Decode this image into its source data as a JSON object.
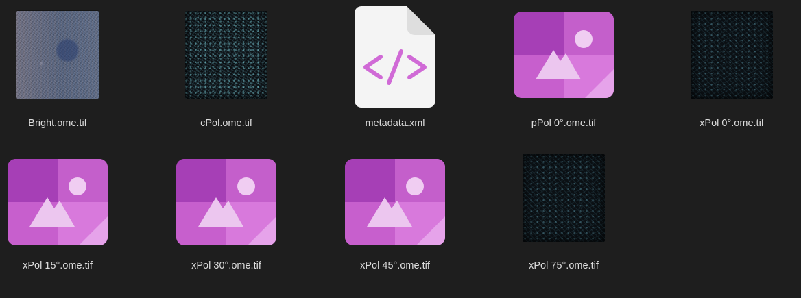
{
  "files": [
    {
      "name": "Bright.ome.tif",
      "thumbnail": "photo-thumbnail"
    },
    {
      "name": "cPol.ome.tif",
      "thumbnail": "photo-thumbnail"
    },
    {
      "name": "metadata.xml",
      "thumbnail": "xml-file-icon"
    },
    {
      "name": "pPol 0°.ome.tif",
      "thumbnail": "image-file-icon"
    },
    {
      "name": "xPol 0°.ome.tif",
      "thumbnail": "photo-thumbnail"
    },
    {
      "name": "xPol 15°.ome.tif",
      "thumbnail": "image-file-icon"
    },
    {
      "name": "xPol 30°.ome.tif",
      "thumbnail": "image-file-icon"
    },
    {
      "name": "xPol 45°.ome.tif",
      "thumbnail": "image-file-icon"
    },
    {
      "name": "xPol 75°.ome.tif",
      "thumbnail": "photo-thumbnail"
    }
  ],
  "colors": {
    "background": "#1e1e1e",
    "label": "#dcdcdc",
    "image_icon_primary": "#c158c8",
    "xml_icon_accent": "#d06ad6"
  }
}
